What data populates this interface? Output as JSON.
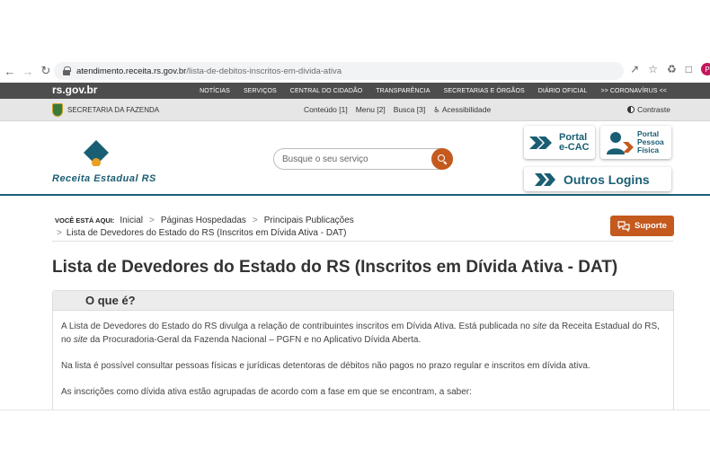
{
  "browser": {
    "url_host": "atendimento.receita.rs.gov.br",
    "url_path": "/lista-de-debitos-inscritos-em-divida-ativa",
    "profile_initial": "P"
  },
  "gov_bar": {
    "logo": "rs.gov.br",
    "menu": [
      "NOTÍCIAS",
      "SERVIÇOS",
      "CENTRAL DO CIDADÃO",
      "TRANSPARÊNCIA",
      "SECRETARIAS E ÓRGÃOS",
      "DIÁRIO OFICIAL",
      ">> CORONAVÍRUS <<"
    ]
  },
  "secondary_bar": {
    "secretaria": "SECRETARIA DA FAZENDA",
    "links": [
      "Conteúdo [1]",
      "Menu [2]",
      "Busca [3]",
      "Acessibilidade"
    ],
    "contraste": "Contraste"
  },
  "header": {
    "logo_text": "Receita Estadual RS",
    "search_placeholder": "Busque o seu serviço",
    "portal_ecac": [
      "Portal",
      "e-CAC"
    ],
    "portal_pf": [
      "Portal",
      "Pessoa",
      "Física"
    ],
    "outros_logins": "Outros Logins"
  },
  "breadcrumb": {
    "label": "VOCÊ ESTÁ AQUI:",
    "items": [
      "Inicial",
      "Páginas Hospedadas",
      "Principais Publicações",
      "Lista de Devedores do Estado do RS (Inscritos em Dívida Ativa - DAT)"
    ]
  },
  "suporte": "Suporte",
  "page_title": "Lista de Devedores do Estado do RS (Inscritos em Dívida Ativa - DAT)",
  "accordion": {
    "title": "O que é?",
    "p1_a": "A Lista de Devedores do Estado do RS divulga a relação de contribuintes inscritos em Dívida Ativa. Está publicada no ",
    "p1_site1": "site",
    "p1_b": " da Receita Estadual do RS, no ",
    "p1_site2": "site",
    "p1_c": " da Procuradoria-Geral da Fazenda Nacional – PGFN e no Aplicativo Dívida Aberta.",
    "p2": "Na lista é possível consultar pessoas  físicas e jurídicas detentoras de débitos não pagos no prazo regular e inscritos em dívida ativa.",
    "p3": "As inscrições como dívida ativa estão agrupadas de acordo com a fase em que se encontram, a saber:"
  },
  "colors": {
    "brand_teal": "#1a5e73",
    "accent_orange": "#c45a1e",
    "gov_bar": "#4d4d4d"
  }
}
